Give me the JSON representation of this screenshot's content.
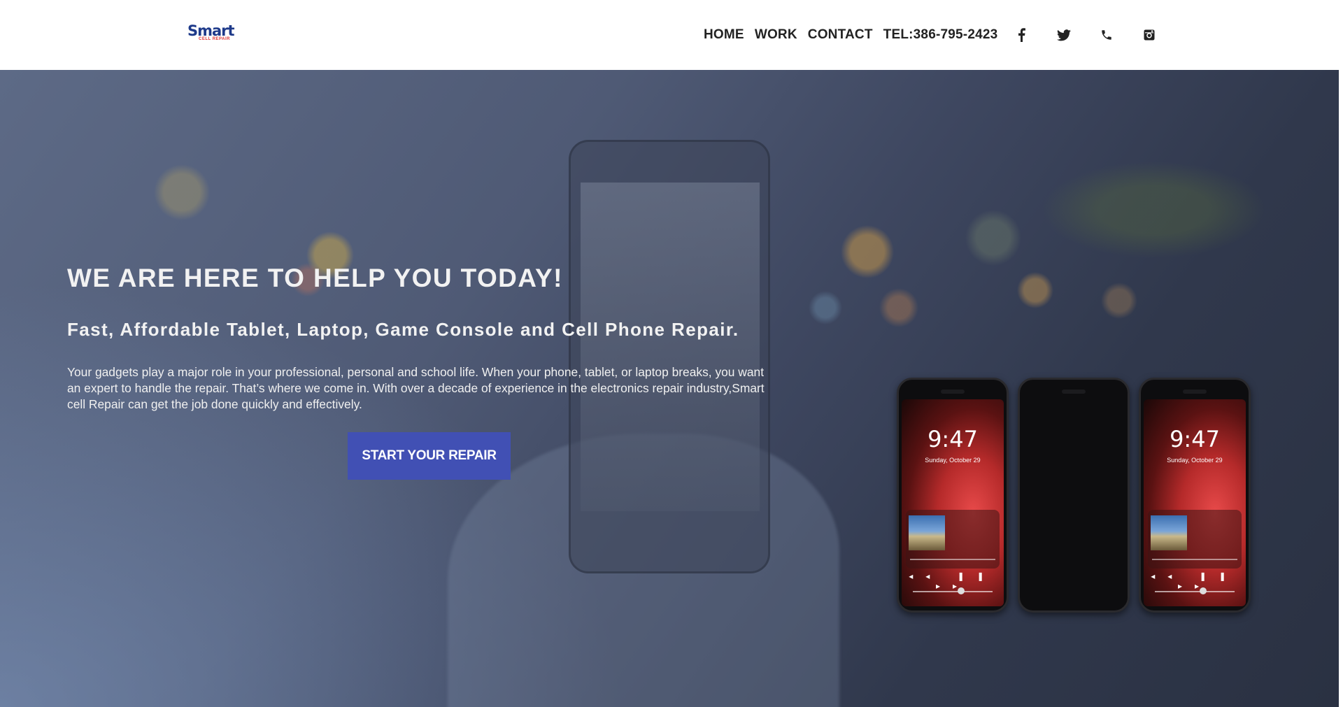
{
  "header": {
    "logo": {
      "main": "Smart",
      "sub": "CELL REPAIR"
    },
    "nav": [
      {
        "label": "HOME"
      },
      {
        "label": "WORK"
      },
      {
        "label": "CONTACT"
      },
      {
        "label": "TEL:386-795-2423"
      }
    ],
    "social_icons": [
      "facebook-icon",
      "twitter-icon",
      "phone-icon",
      "instagram-icon"
    ]
  },
  "hero": {
    "title": "WE ARE HERE TO HELP YOU TODAY!",
    "subtitle": "Fast, Affordable Tablet, Laptop, Game Console and Cell Phone Repair.",
    "text": "Your gadgets play a major role in your professional, personal and school life. When your phone, tablet, or laptop breaks, you want an expert to handle the repair. That’s where we come in. With over a decade of experience in the electronics repair industry,Smart cell Repair can get the job done quickly and effectively.",
    "cta_label": "START YOUR REPAIR"
  },
  "phones": {
    "time": "9:47",
    "date": "Sunday, October 29"
  },
  "colors": {
    "cta": "#4150b4",
    "logo": "#1e3a8a",
    "nav_text": "#222222"
  }
}
